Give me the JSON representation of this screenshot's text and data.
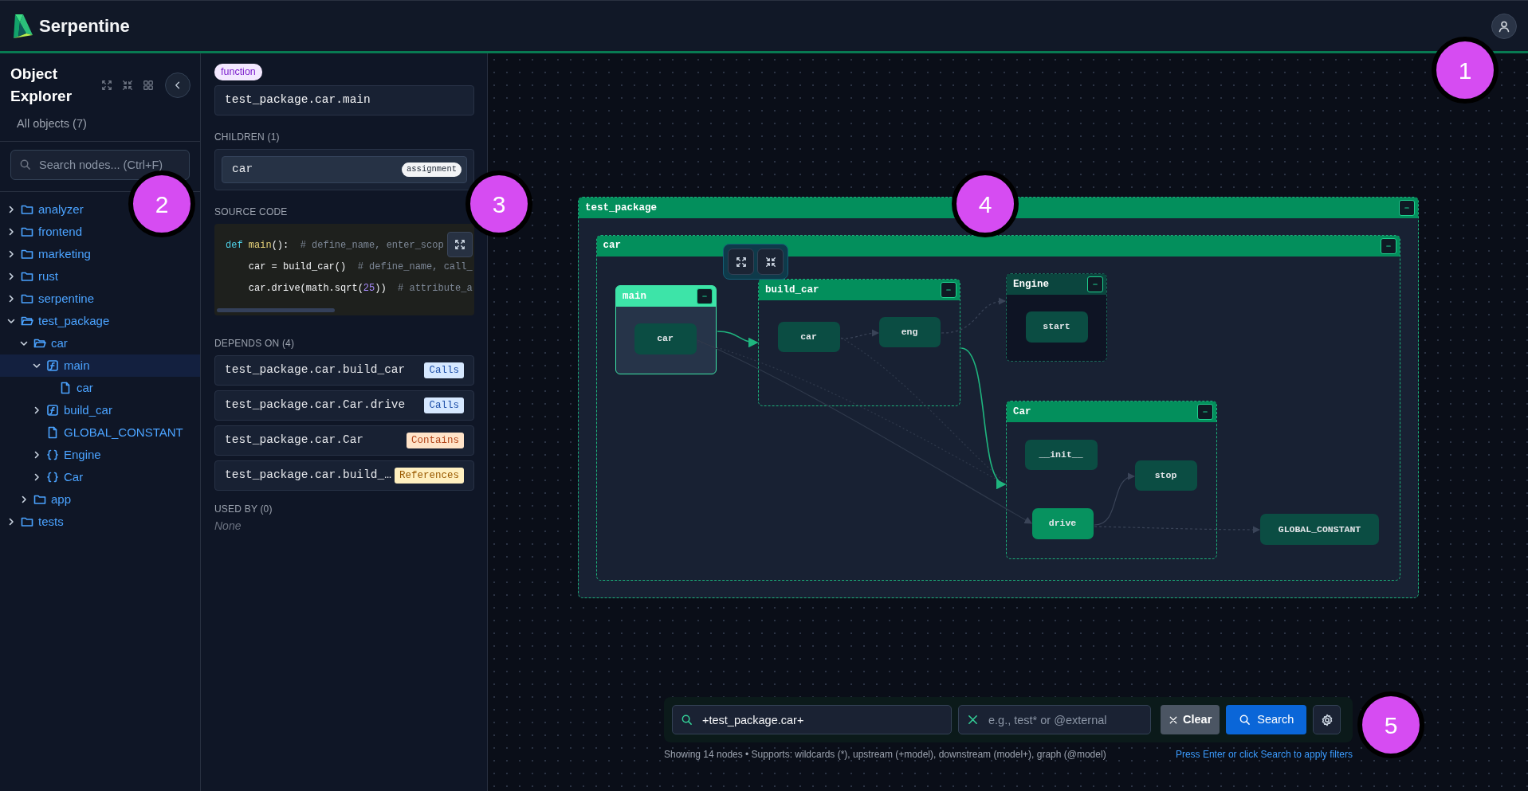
{
  "header": {
    "brand": "Serpentine"
  },
  "sidebar": {
    "title": "Object Explorer",
    "subtitle": "All objects (7)",
    "search": {
      "placeholder": "Search nodes... (Ctrl+F)"
    },
    "tree": [
      {
        "label": "analyzer",
        "kind": "folder",
        "expanded": false,
        "selected": false
      },
      {
        "label": "frontend",
        "kind": "folder",
        "expanded": false,
        "selected": false
      },
      {
        "label": "marketing",
        "kind": "folder",
        "expanded": false,
        "selected": false
      },
      {
        "label": "rust",
        "kind": "folder",
        "expanded": false,
        "selected": false
      },
      {
        "label": "serpentine",
        "kind": "folder",
        "expanded": false,
        "selected": false
      },
      {
        "label": "test_package",
        "kind": "folder",
        "expanded": true,
        "selected": false,
        "children": [
          {
            "label": "car",
            "kind": "folder",
            "expanded": true,
            "selected": false,
            "children": [
              {
                "label": "main",
                "kind": "function",
                "expanded": true,
                "selected": true,
                "children": [
                  {
                    "label": "car",
                    "kind": "file",
                    "selected": false
                  }
                ]
              },
              {
                "label": "build_car",
                "kind": "function",
                "expanded": false,
                "selected": false
              },
              {
                "label": "GLOBAL_CONSTANT",
                "kind": "file",
                "selected": false
              },
              {
                "label": "Engine",
                "kind": "class",
                "expanded": false,
                "selected": false
              },
              {
                "label": "Car",
                "kind": "class",
                "expanded": false,
                "selected": false
              }
            ]
          },
          {
            "label": "app",
            "kind": "folder",
            "expanded": false,
            "selected": false
          }
        ]
      },
      {
        "label": "tests",
        "kind": "folder",
        "expanded": false,
        "selected": false
      }
    ]
  },
  "details": {
    "type_badge": "function",
    "name": "test_package.car.main",
    "children_heading": "CHILDREN (1)",
    "children": [
      {
        "name": "car",
        "badge": "assignment"
      }
    ],
    "source_heading": "SOURCE CODE",
    "source_lines": [
      [
        {
          "text": "def",
          "kind": "keyword"
        },
        {
          "text": " main",
          "kind": "function"
        },
        {
          "text": "():",
          "kind": "plain"
        },
        {
          "text": "  # define_name, enter_scop",
          "kind": "comment"
        }
      ],
      [
        {
          "text": "    car = build_car()",
          "kind": "plain"
        },
        {
          "text": "  # define_name, call_",
          "kind": "comment"
        }
      ],
      [
        {
          "text": "    car.drive(math.sqrt(",
          "kind": "plain"
        },
        {
          "text": "25",
          "kind": "number"
        },
        {
          "text": "))",
          "kind": "plain"
        },
        {
          "text": "  # attribute_a",
          "kind": "comment"
        }
      ]
    ],
    "depends_heading": "DEPENDS ON (4)",
    "depends_on": [
      {
        "name": "test_package.car.build_car",
        "relation": "Calls",
        "kind": "calls"
      },
      {
        "name": "test_package.car.Car.drive",
        "relation": "Calls",
        "kind": "calls"
      },
      {
        "name": "test_package.car.Car",
        "relation": "Contains",
        "kind": "contains"
      },
      {
        "name": "test_package.car.build_…",
        "relation": "References",
        "kind": "references"
      }
    ],
    "used_by_heading": "USED BY (0)",
    "used_by_empty": "None"
  },
  "graph": {
    "nodes": [
      {
        "label": "test_package",
        "kind": "container",
        "selected": false,
        "dimmed": false,
        "children": [
          {
            "label": "car",
            "kind": "container",
            "selected": false,
            "dimmed": false,
            "children": [
              {
                "label": "main",
                "kind": "container",
                "selected": true,
                "dimmed": false,
                "children": [
                  {
                    "label": "car",
                    "kind": "node",
                    "highlighted": false
                  }
                ]
              },
              {
                "label": "build_car",
                "kind": "container",
                "selected": false,
                "dimmed": false,
                "children": [
                  {
                    "label": "car",
                    "kind": "node",
                    "highlighted": false
                  },
                  {
                    "label": "eng",
                    "kind": "node",
                    "highlighted": false
                  }
                ]
              },
              {
                "label": "Engine",
                "kind": "container",
                "selected": false,
                "dimmed": true,
                "children": [
                  {
                    "label": "start",
                    "kind": "node",
                    "highlighted": false
                  }
                ]
              },
              {
                "label": "Car",
                "kind": "container",
                "selected": false,
                "dimmed": false,
                "children": [
                  {
                    "label": "__init__",
                    "kind": "node",
                    "highlighted": false
                  },
                  {
                    "label": "stop",
                    "kind": "node",
                    "highlighted": false
                  },
                  {
                    "label": "drive",
                    "kind": "node",
                    "highlighted": true
                  }
                ]
              },
              {
                "label": "GLOBAL_CONSTANT",
                "kind": "node",
                "highlighted": false
              }
            ]
          }
        ]
      }
    ]
  },
  "filter_bar": {
    "select_value": "+test_package.car+",
    "exclude_placeholder": "e.g., test* or @external",
    "clear": "Clear",
    "search": "Search",
    "status": "Showing 14 nodes • Supports: wildcards (*), upstream (+model), downstream (model+), graph (@model)",
    "hint": "Press Enter or click Search to apply filters"
  },
  "callouts": [
    {
      "label": "1"
    },
    {
      "label": "2"
    },
    {
      "label": "3"
    },
    {
      "label": "4"
    },
    {
      "label": "5"
    }
  ]
}
